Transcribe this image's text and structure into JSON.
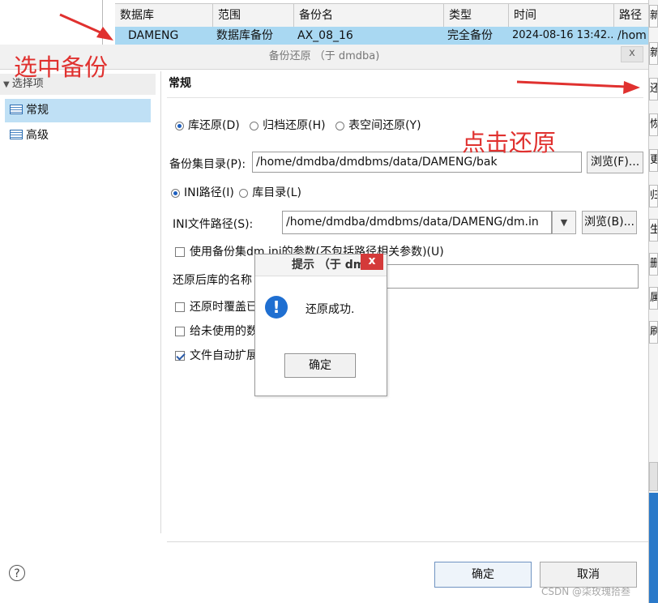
{
  "backup_table": {
    "columns": [
      "数据库",
      "范围",
      "备份名",
      "类型",
      "时间",
      "路径"
    ],
    "selected_row": [
      "DAMENG",
      "数据库备份",
      "AX_08_16",
      "完全备份",
      "2024-08-16 13:42...",
      "/hom"
    ]
  },
  "right_strip": {
    "buttons": [
      "新",
      "新",
      "还",
      "恢",
      "更",
      "归",
      "生",
      "删",
      "属",
      "刷"
    ]
  },
  "dialog": {
    "title": "备份还原 （于 dmdba)",
    "close_label": "x",
    "nav": {
      "header": "选择项",
      "items": [
        "常规",
        "高级"
      ]
    },
    "section_title": "常规",
    "restore_type": {
      "options": [
        "库还原(D)",
        "归档还原(H)",
        "表空间还原(Y)"
      ],
      "selected": "库还原(D)"
    },
    "backup_dir": {
      "label": "备份集目录(P):",
      "value": "/home/dmdba/dmdbms/data/DAMENG/bak",
      "browse_label": "浏览(F)..."
    },
    "path_mode": {
      "options": [
        "INI路径(I)",
        "库目录(L)"
      ],
      "selected": "INI路径(I)"
    },
    "ini_path": {
      "label": "INI文件路径(S):",
      "value": "/home/dmdba/dmdbms/data/DAMENG/dm.in",
      "dropdown_glyph": "▼",
      "browse_label": "浏览(B)..."
    },
    "use_backup_ini": {
      "label": "使用备份集dm.ini的参数(不包括路径相关参数)(U)",
      "checked": false
    },
    "restored_db_name": {
      "label": "还原后库的名称"
    },
    "checkboxes": [
      {
        "label": "还原时覆盖已",
        "checked": false
      },
      {
        "label": "给未使用的数",
        "checked": false
      },
      {
        "label": "文件自动扩展",
        "checked": true
      }
    ],
    "ok_label": "确定",
    "cancel_label": "取消",
    "help_glyph": "?"
  },
  "popup": {
    "title": "提示  （于 dm",
    "close_label": "x",
    "message": "还原成功.",
    "ok_label": "确定",
    "icon_glyph": "!"
  },
  "annotations": {
    "select_backup": "选中备份",
    "click_restore": "点击还原",
    "color": "#e0312f"
  },
  "watermark": "CSDN @柒玫瑰拾叁"
}
